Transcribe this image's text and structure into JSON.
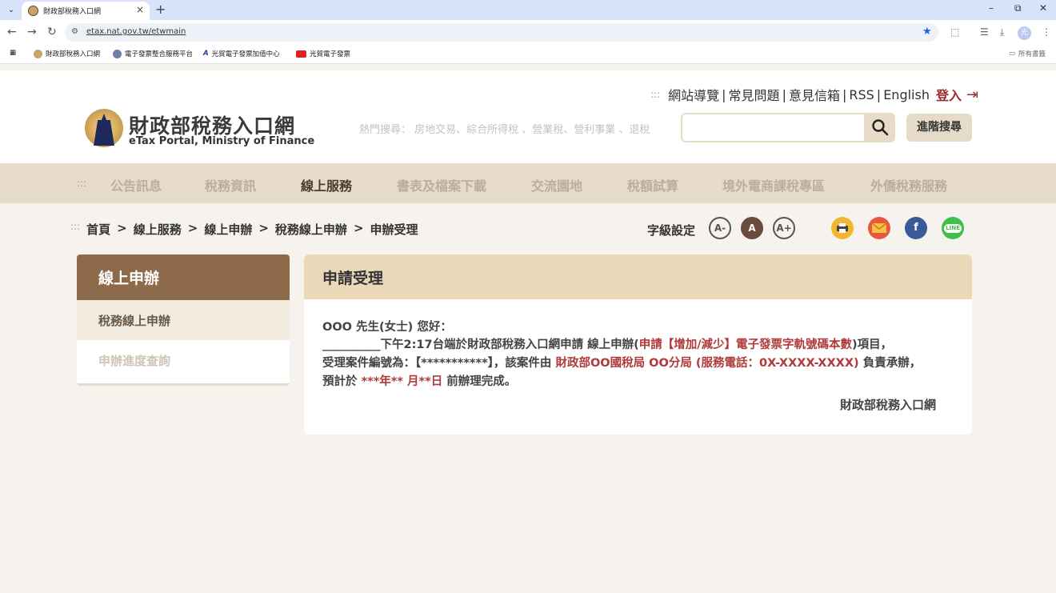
{
  "browser": {
    "tab_title": "財政部稅務入口網",
    "url": "etax.nat.gov.tw/etwmain",
    "profile_initial": "光",
    "bookmarks": [
      {
        "label": "財政部稅務入口網",
        "color": "#c9a36a"
      },
      {
        "label": "電子發票整合服務平台",
        "color": "#6a7fa8"
      },
      {
        "label": "光貿電子發票加值中心",
        "color": "#1f3f9a"
      },
      {
        "label": "光貿電子發票",
        "color": "#e02020"
      }
    ],
    "all_bookmarks": "所有書籤"
  },
  "site": {
    "title": "財政部稅務入口網",
    "subtitle": "eTax Portal, Ministry of Finance"
  },
  "toplinks": {
    "items": [
      "網站導覽",
      "常見問題",
      "意見信箱",
      "RSS",
      "English"
    ],
    "login": "登入"
  },
  "search": {
    "hot_prefix": "熱門搜尋：",
    "hot_terms": "房地交易、綜合所得稅 、營業稅、營利事業 、退稅",
    "placeholder": "",
    "advanced_label": "進階搜尋"
  },
  "nav": {
    "items": [
      "公告訊息",
      "稅務資訊",
      "線上服務",
      "書表及檔案下載",
      "交流園地",
      "稅額試算",
      "境外電商課稅專區",
      "外僑稅務服務"
    ],
    "active": "線上服務"
  },
  "breadcrumb": [
    "首頁",
    ">",
    "線上服務",
    ">",
    "線上申辦",
    ">",
    "稅務線上申辦",
    ">",
    "申辦受理"
  ],
  "fontset": {
    "label": "字級設定",
    "small": "A-",
    "normal": "A",
    "large": "A+"
  },
  "share": {
    "line_label": "LINE",
    "fb_label": "f"
  },
  "sidebar": {
    "heading": "線上申辦",
    "items": [
      "稅務線上申辦",
      "申辦進度查詢"
    ]
  },
  "content": {
    "heading": "申請受理",
    "greeting": "OOO 先生(女士) 您好：",
    "line2_prefix": "__________下午2:17台端於財政部稅務入口網申請 線上申辦(",
    "line2_red": "申請【增加/減少】電子發票字軌號碼本數",
    "line2_suffix": ")項目，",
    "line3_prefix": "受理案件編號為：【***********】，該案件由 ",
    "line3_red": "財政部OO國稅局 OO分局 (服務電話：0X-XXXX-XXXX)",
    "line3_suffix": " 負責承辦，",
    "line4_prefix": "預計於  ",
    "line4_red": "***年** 月**日",
    "line4_suffix": " 前辦理完成。",
    "signature": "財政部稅務入口網"
  }
}
